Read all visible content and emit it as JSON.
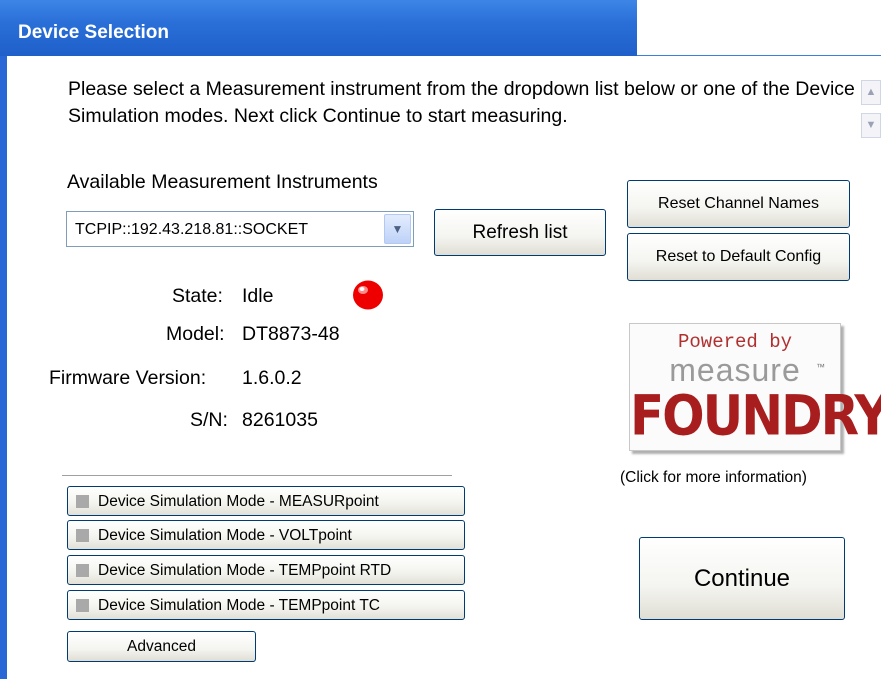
{
  "window": {
    "title": "Device Selection"
  },
  "instructions": "Please select a Measurement instrument from the dropdown list below or one of the Device Simulation modes.  Next click Continue to start measuring.",
  "instruments": {
    "label": "Available Measurement Instruments",
    "selected": "TCPIP::192.43.218.81::SOCKET",
    "refresh_label": "Refresh list"
  },
  "device": {
    "state_label": "State:",
    "state_value": "Idle",
    "state_color": "#ee0000",
    "model_label": "Model:",
    "model_value": "DT8873-48",
    "firmware_label": "Firmware Version:",
    "firmware_value": "1.6.0.2",
    "sn_label": "S/N:",
    "sn_value": "8261035"
  },
  "config": {
    "reset_channels_label": "Reset Channel Names",
    "reset_default_label": "Reset to Default Config"
  },
  "logo": {
    "powered_by": "Powered by",
    "measure": "measure",
    "tm": "™",
    "foundry": "FOUNDRY",
    "caption": "(Click for more information)"
  },
  "simulation": {
    "modes": [
      "Device Simulation Mode - MEASURpoint",
      "Device Simulation Mode - VOLTpoint",
      "Device Simulation Mode - TEMPpoint RTD",
      "Device Simulation Mode - TEMPpoint TC"
    ],
    "advanced_label": "Advanced"
  },
  "continue_label": "Continue",
  "colors": {
    "title_bar": "#2a6fd8",
    "button_border": "#003c74",
    "logo_red": "#a81e1e"
  }
}
